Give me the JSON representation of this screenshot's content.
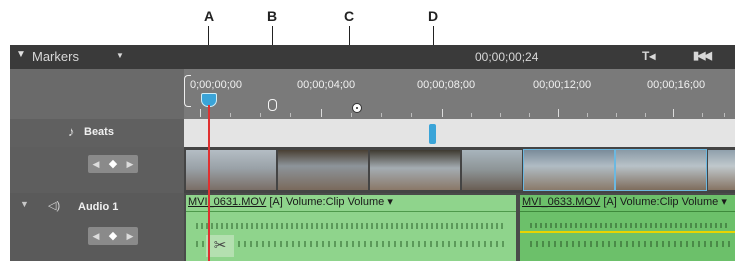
{
  "callouts": [
    "A",
    "B",
    "C",
    "D"
  ],
  "header": {
    "panel_label": "Markers",
    "timecode": "00;00;00;24",
    "set_marker_icon": "T◂",
    "go_start_icon": "▮◀◀"
  },
  "ruler": {
    "labels": [
      "0;00;00;00",
      "00;00;04;00",
      "00;00;08;00",
      "00;00;12;00",
      "00;00;16;00"
    ]
  },
  "tracks": {
    "beats_label": "Beats",
    "audio_label": "Audio 1"
  },
  "audio_clips": [
    {
      "name": "MVI_0631.MOV",
      "suffix": " [A]  Volume:Clip Volume ▾"
    },
    {
      "name": "MVI_0633.MOV",
      "suffix": " [A]  Volume:Clip Volume ▾"
    }
  ],
  "colors": {
    "playhead": "#e03030",
    "marker": "#3aa4d8",
    "clip_green": "#8fd48c",
    "clip_selected": "#6cc06a",
    "volume_line": "#e8d400"
  }
}
